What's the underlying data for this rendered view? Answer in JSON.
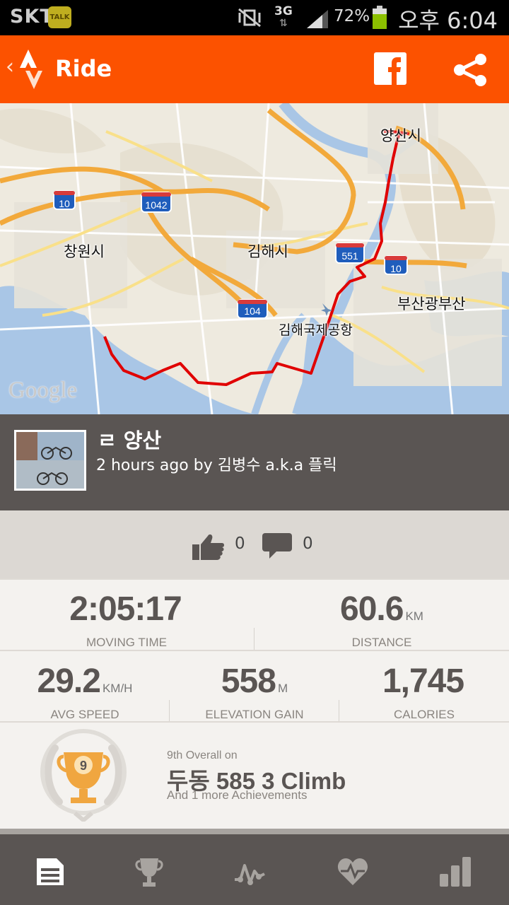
{
  "status_bar": {
    "carrier": "SKT",
    "talk_badge": "TALK",
    "network": "3G",
    "battery": "72%",
    "time": "오후 6:04"
  },
  "app_bar": {
    "title": "Ride"
  },
  "map": {
    "labels": {
      "yangsan": "양산시",
      "changwon": "창원시",
      "gimhae": "김해시",
      "busan": "부산광부산",
      "airport": "김해국제공항",
      "route_10_left": "10",
      "route_1042": "1042",
      "route_551": "551",
      "route_10_right": "10",
      "route_104": "104"
    },
    "attribution": "Google"
  },
  "activity": {
    "title": "ㄹ 양산",
    "subtitle": "2 hours ago by 김병수 a.k.a 플릭"
  },
  "social": {
    "kudos": "0",
    "comments": "0"
  },
  "stats": {
    "moving_time": {
      "value": "2:05:17",
      "unit": "",
      "label": "MOVING TIME"
    },
    "distance": {
      "value": "60.6",
      "unit": "KM",
      "label": "DISTANCE"
    },
    "avg_speed": {
      "value": "29.2",
      "unit": "KM/H",
      "label": "AVG SPEED"
    },
    "elevation": {
      "value": "558",
      "unit": "M",
      "label": "ELEVATION GAIN"
    },
    "calories": {
      "value": "1,745",
      "unit": "",
      "label": "CALORIES"
    }
  },
  "achievement": {
    "rank_number": "9",
    "rank_text": "9th Overall on",
    "segment": "두동 585 3 Climb",
    "more": "And 1 more Achievements"
  },
  "colors": {
    "brand": "#fc5200",
    "header_bg": "#5a5553",
    "route": "#e00000",
    "trophy": "#f0a640"
  },
  "icons": {
    "app_logo": "strava-logo-icon",
    "facebook": "facebook-icon",
    "share": "share-icon",
    "kudos": "thumbs-up-icon",
    "comment": "comment-icon",
    "tabs": [
      "overview-icon",
      "achievements-icon",
      "analysis-icon",
      "heart-rate-icon",
      "stats-icon"
    ]
  }
}
